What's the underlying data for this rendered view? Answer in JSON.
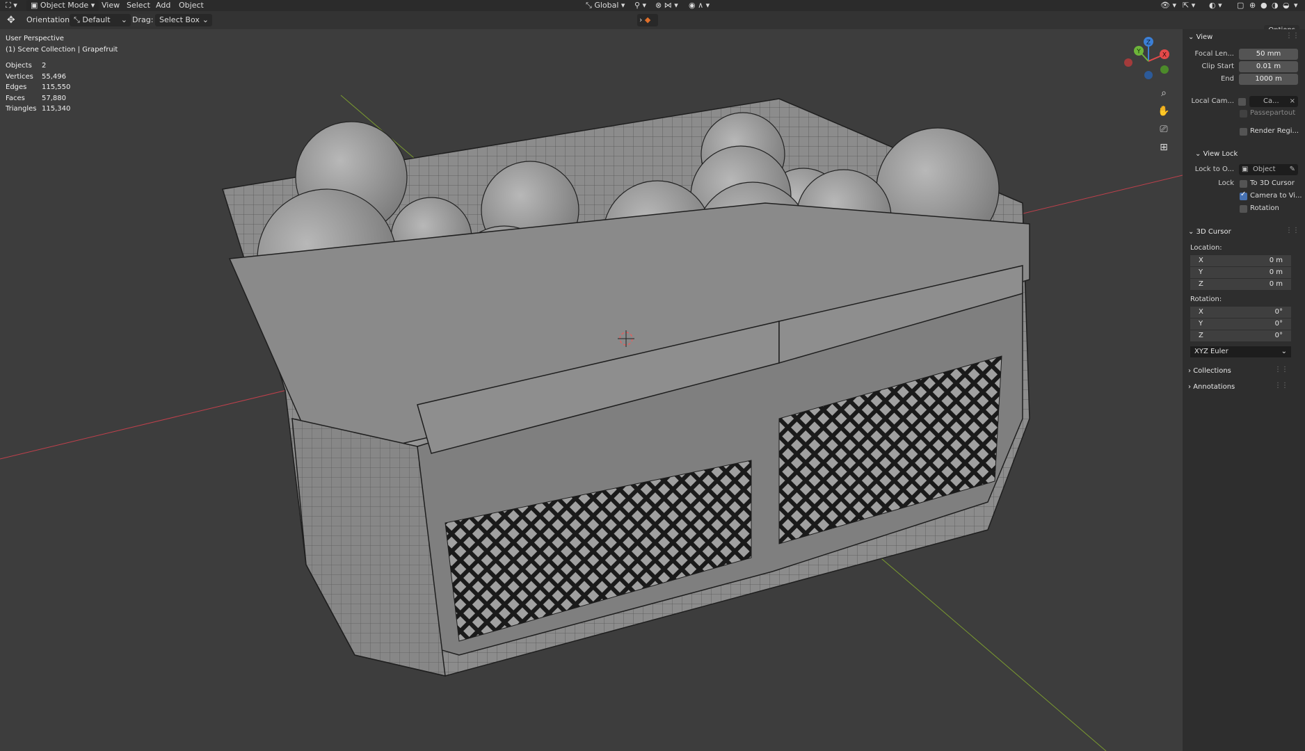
{
  "header": {
    "mode": "Object Mode",
    "menus": [
      "View",
      "Select",
      "Add",
      "Object"
    ],
    "transform_orientation": "Global"
  },
  "tool_settings": {
    "orientation_label": "Orientation:",
    "orientation_value": "Default",
    "drag_label": "Drag:",
    "drag_value": "Select Box",
    "options_label": "Options"
  },
  "viewport": {
    "view_name": "User Perspective",
    "collection": "(1) Scene Collection | Grapefruit",
    "stats": [
      {
        "label": "Objects",
        "value": "2"
      },
      {
        "label": "Vertices",
        "value": "55,496"
      },
      {
        "label": "Edges",
        "value": "115,550"
      },
      {
        "label": "Faces",
        "value": "57,880"
      },
      {
        "label": "Triangles",
        "value": "115,340"
      }
    ],
    "gizmo_axes": [
      "X",
      "Y",
      "Z"
    ]
  },
  "sidebar": {
    "view_panel": {
      "title": "View",
      "focal_length_label": "Focal Len...",
      "focal_length": "50 mm",
      "clip_start_label": "Clip Start",
      "clip_start": "0.01 m",
      "clip_end_label": "End",
      "clip_end": "1000 m",
      "local_camera_label": "Local Cam...",
      "local_camera_value": "Ca...",
      "passepartout_label": "Passepartout",
      "render_region_label": "Render Regi..."
    },
    "view_lock": {
      "title": "View Lock",
      "lock_to_object_label": "Lock to O...",
      "lock_to_object_placeholder": "Object",
      "lock_label": "Lock",
      "to_3d_cursor": {
        "label": "To 3D Cursor",
        "checked": false
      },
      "camera_to_view": {
        "label": "Camera to Vi...",
        "checked": true
      },
      "rotation": {
        "label": "Rotation",
        "checked": false
      }
    },
    "cursor": {
      "title": "3D Cursor",
      "location_label": "Location:",
      "location": [
        {
          "axis": "X",
          "value": "0 m"
        },
        {
          "axis": "Y",
          "value": "0 m"
        },
        {
          "axis": "Z",
          "value": "0 m"
        }
      ],
      "rotation_label": "Rotation:",
      "rotation": [
        {
          "axis": "X",
          "value": "0°"
        },
        {
          "axis": "Y",
          "value": "0°"
        },
        {
          "axis": "Z",
          "value": "0°"
        }
      ],
      "rotation_mode": "XYZ Euler"
    },
    "collapsed_panels": [
      "Collections",
      "Annotations"
    ]
  },
  "colors": {
    "viewport_bg": "#3d3d3d",
    "mesh": "#8f8f8f",
    "wire": "#1e1e1e",
    "axis_x": "#c0404c",
    "axis_y": "#7a9a30",
    "gizmo_x": "#e34a4a",
    "gizmo_y": "#6db53a",
    "gizmo_z": "#3b7fd6",
    "checkbox_on": "#4772b3"
  }
}
